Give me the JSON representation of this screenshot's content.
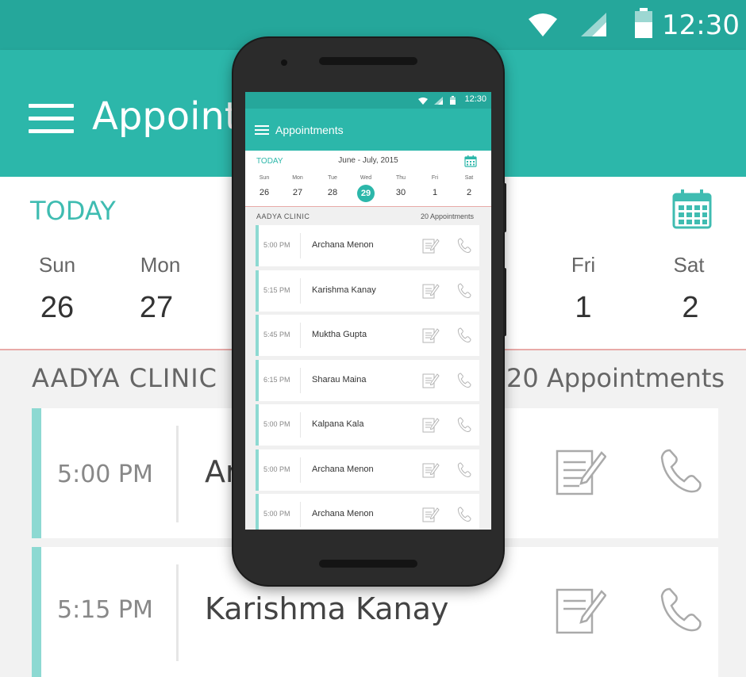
{
  "status": {
    "time": "12:30"
  },
  "app": {
    "title": "Appointments"
  },
  "calendar": {
    "today_label": "TODAY",
    "range": "June - July, 2015",
    "days": [
      {
        "name": "Sun",
        "date": "26"
      },
      {
        "name": "Mon",
        "date": "27"
      },
      {
        "name": "Tue",
        "date": "28"
      },
      {
        "name": "Wed",
        "date": "29"
      },
      {
        "name": "Thu",
        "date": "30"
      },
      {
        "name": "Fri",
        "date": "1"
      },
      {
        "name": "Sat",
        "date": "2"
      }
    ],
    "selected": "29"
  },
  "clinic": {
    "name": "AADYA CLINIC",
    "count": "20 Appointments"
  },
  "appointments": [
    {
      "time": "5:00 PM",
      "name": "Archana Menon"
    },
    {
      "time": "5:15 PM",
      "name": "Karishma Kanay"
    },
    {
      "time": "5:45 PM",
      "name": "Muktha Gupta"
    },
    {
      "time": "6:15 PM",
      "name": "Sharau Maina"
    },
    {
      "time": "5:00 PM",
      "name": "Kalpana Kala"
    },
    {
      "time": "5:00 PM",
      "name": "Archana Menon"
    },
    {
      "time": "5:00 PM",
      "name": "Archana Menon"
    }
  ],
  "background": {
    "title": "Appointr",
    "card_names": [
      "Ar",
      "Karishma Kanay"
    ]
  },
  "colors": {
    "primary": "#2cb7aa",
    "status_bar": "#25a79b",
    "card_accent": "#8dd9d2",
    "divider": "#e8aaa8"
  },
  "icons": [
    "wifi-icon",
    "signal-icon",
    "battery-icon",
    "menu-icon",
    "calendar-icon",
    "notes-icon",
    "phone-icon"
  ]
}
